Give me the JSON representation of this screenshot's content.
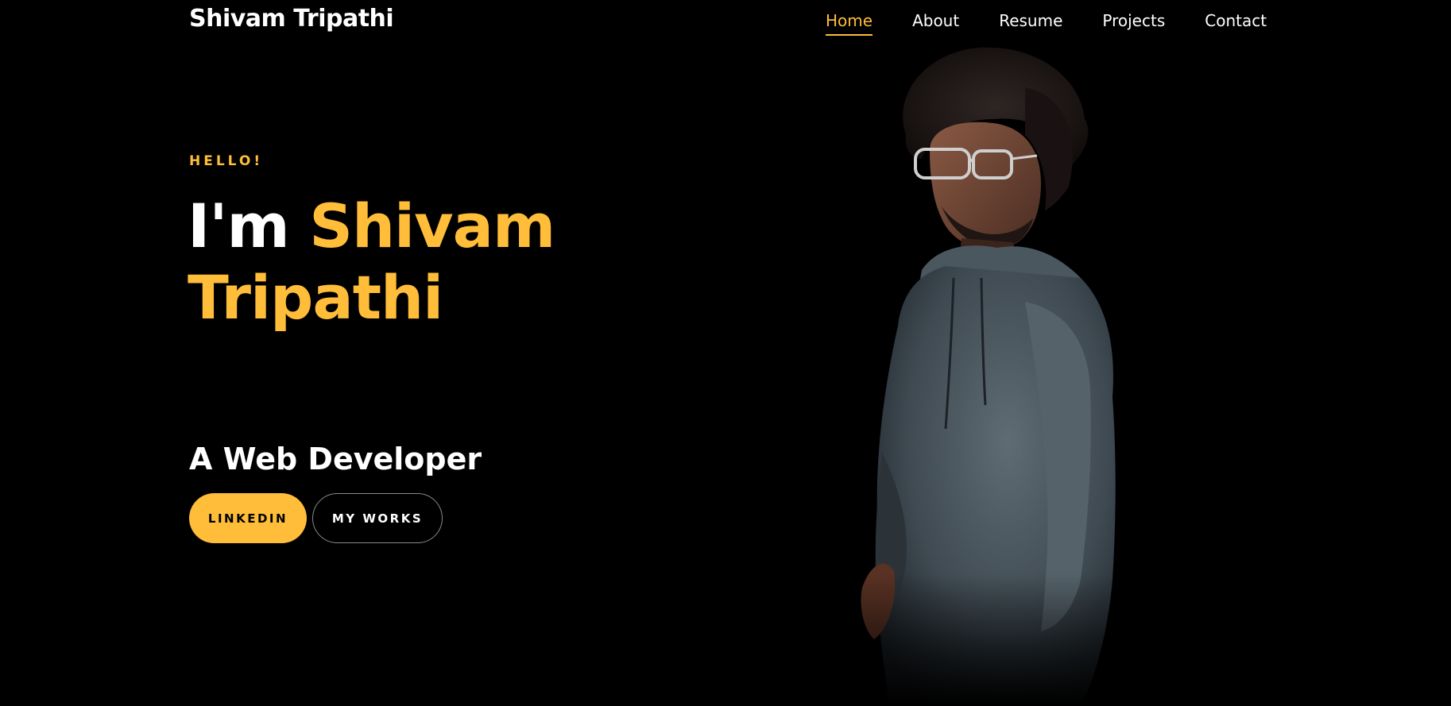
{
  "header": {
    "brand": "Shivam Tripathi",
    "nav": [
      {
        "label": "Home",
        "active": true
      },
      {
        "label": "About",
        "active": false
      },
      {
        "label": "Resume",
        "active": false
      },
      {
        "label": "Projects",
        "active": false
      },
      {
        "label": "Contact",
        "active": false
      }
    ]
  },
  "hero": {
    "greeting": "HELLO!",
    "intro": "I'm",
    "name_first": "Shivam",
    "name_last": "Tripathi",
    "role": "A Web Developer",
    "buttons": {
      "primary": "LINKEDIN",
      "secondary": "MY WORKS"
    }
  },
  "colors": {
    "accent": "#ffbd39",
    "background": "#000000",
    "text": "#ffffff"
  },
  "icons": {
    "portrait": "person-portrait"
  }
}
